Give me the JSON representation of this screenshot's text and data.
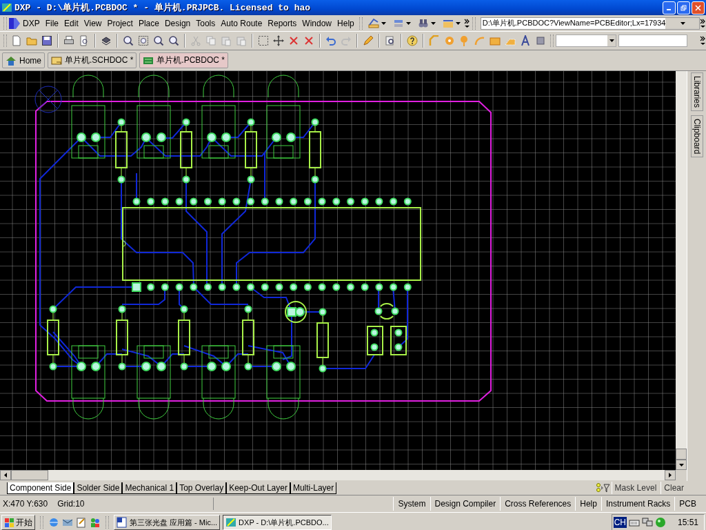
{
  "window": {
    "title": "DXP - D:\\单片机.PCBDOC * - 单片机.PRJPCB. Licensed to hao"
  },
  "menu": [
    "DXP",
    "File",
    "Edit",
    "View",
    "Project",
    "Place",
    "Design",
    "Tools",
    "Auto Route",
    "Reports",
    "Window",
    "Help"
  ],
  "address": {
    "value": "D:\\单片机.PCBDOC?ViewName=PCBEditor;Lx=17934"
  },
  "doc_tabs": [
    {
      "label": "Home",
      "selected": false
    },
    {
      "label": "单片机.SCHDOC *",
      "selected": false
    },
    {
      "label": "单片机.PCBDOC *",
      "selected": true
    }
  ],
  "side_panels": [
    "Libraries",
    "Clipboard"
  ],
  "layer_tabs": [
    {
      "label": "Component Side",
      "selected": true
    },
    {
      "label": "Solder Side",
      "selected": false
    },
    {
      "label": "Mechanical 1",
      "selected": false
    },
    {
      "label": "Top Overlay",
      "selected": false
    },
    {
      "label": "Keep-Out Layer",
      "selected": false
    },
    {
      "label": "Multi-Layer",
      "selected": false
    }
  ],
  "mask": {
    "mask_level": "Mask Level",
    "clear": "Clear"
  },
  "status": {
    "coords": "X:470 Y:630",
    "grid": "Grid:10"
  },
  "panel_buttons": [
    "System",
    "Design Compiler",
    "Cross References",
    "Help",
    "Instrument Racks",
    "PCB"
  ],
  "taskbar": {
    "start": "开始",
    "tasks": [
      {
        "label": "第三张光盘 应用篇 - Mic...",
        "selected": false
      },
      {
        "label": "DXP - D:\\单片机.PCBDO...",
        "selected": true
      }
    ],
    "ime": "CH",
    "time": "15:51"
  }
}
